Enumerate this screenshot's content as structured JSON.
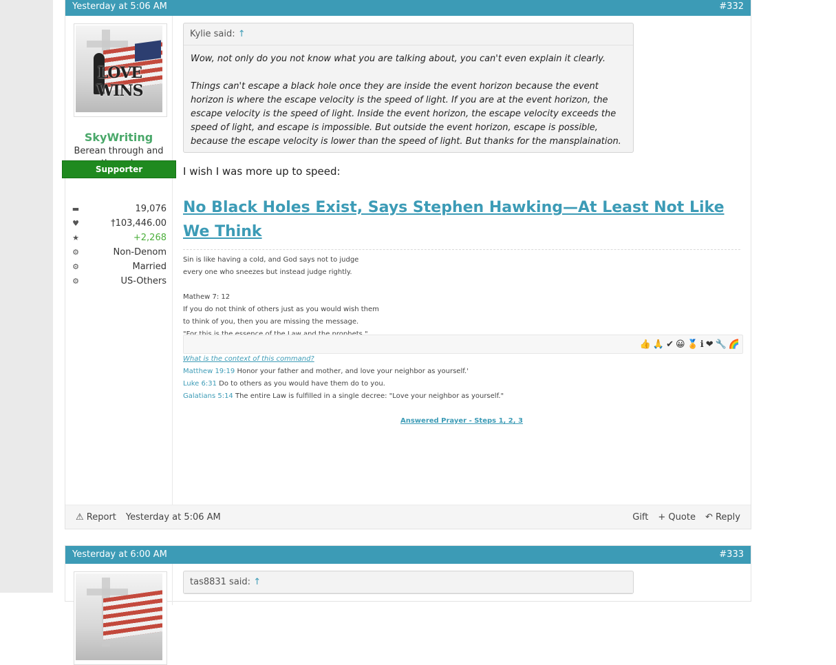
{
  "posts": [
    {
      "header_time": "Yesterday at 5:06 AM",
      "post_number": "#332",
      "user": {
        "name": "SkyWriting",
        "title": "Berean through and through",
        "badge": "Supporter",
        "avatar_text": "LOVE WINS",
        "stats": [
          {
            "icon": "comments-icon",
            "glyph": "▬",
            "value": "19,076"
          },
          {
            "icon": "heart-icon",
            "glyph": "♥",
            "value": "†103,446.00"
          },
          {
            "icon": "star-icon",
            "glyph": "★",
            "value": "+2,268"
          },
          {
            "icon": "gear-icon",
            "glyph": "⚙",
            "value": "Non-Denom"
          },
          {
            "icon": "gear-icon",
            "glyph": "⚙",
            "value": "Married"
          },
          {
            "icon": "gear-icon",
            "glyph": "⚙",
            "value": "US-Others"
          }
        ]
      },
      "quote": {
        "author": "Kylie said:",
        "arrow": "↑",
        "paragraphs": [
          "Wow, not only do you not know what you are talking about, you can't even explain it clearly.",
          "Things can't escape a black hole once they are inside the event horizon because the event horizon is where the escape velocity is the speed of light. If you are at the event horizon, the escape velocity is the speed of light. Inside the event horizon, the escape velocity exceeds the speed of light, and escape is impossible. But outside the event horizon, escape is possible, because the escape velocity is lower than the speed of light. But thanks for the mansplaination."
        ]
      },
      "message": "I wish I was more up to speed:",
      "link_title": "No Black Holes Exist, Says Stephen Hawking—At Least Not Like We Think",
      "signature": {
        "line1": "Sin is like having a cold, and God says not to judge",
        "line2": "every one who sneezes but instead judge rightly.",
        "line3": "Mathew 7: 12",
        "line4": "If you do not think of others just as you would wish them",
        "line5": "to think of you, then you are missing the message.",
        "line6": "\"For this is the essence of the Law and the prophets.\"",
        "context_link": "What is the context of this command?",
        "verses": [
          {
            "ref": "Matthew 19:19",
            "text": " Honor your father and mother, and love your neighbor as yourself.'"
          },
          {
            "ref": "Luke 6:31",
            "text": " Do to others as you would have them do to you."
          },
          {
            "ref": "Galatians 5:14",
            "text": " The entire Law is fulfilled in a single decree: \"Love your neighbor as yourself.\""
          }
        ],
        "bottom_link": "Answered Prayer - Steps 1, 2, 3"
      },
      "reactions": [
        "👍",
        "🙏",
        "✔",
        "😀",
        "🏅",
        "ℹ",
        "❤",
        "🔧",
        "🌈"
      ],
      "footer": {
        "report": "Report",
        "time": "Yesterday at 5:06 AM",
        "gift": "Gift",
        "quote": "+ Quote",
        "reply": "Reply"
      }
    },
    {
      "header_time": "Yesterday at 6:00 AM",
      "post_number": "#333",
      "quote_author": "tas8831 said:",
      "arrow": "↑"
    }
  ],
  "colors": {
    "header": "#3c9bb6",
    "username": "#4aa86a",
    "badge": "#1f8a1f",
    "link": "#3c9bb6"
  }
}
